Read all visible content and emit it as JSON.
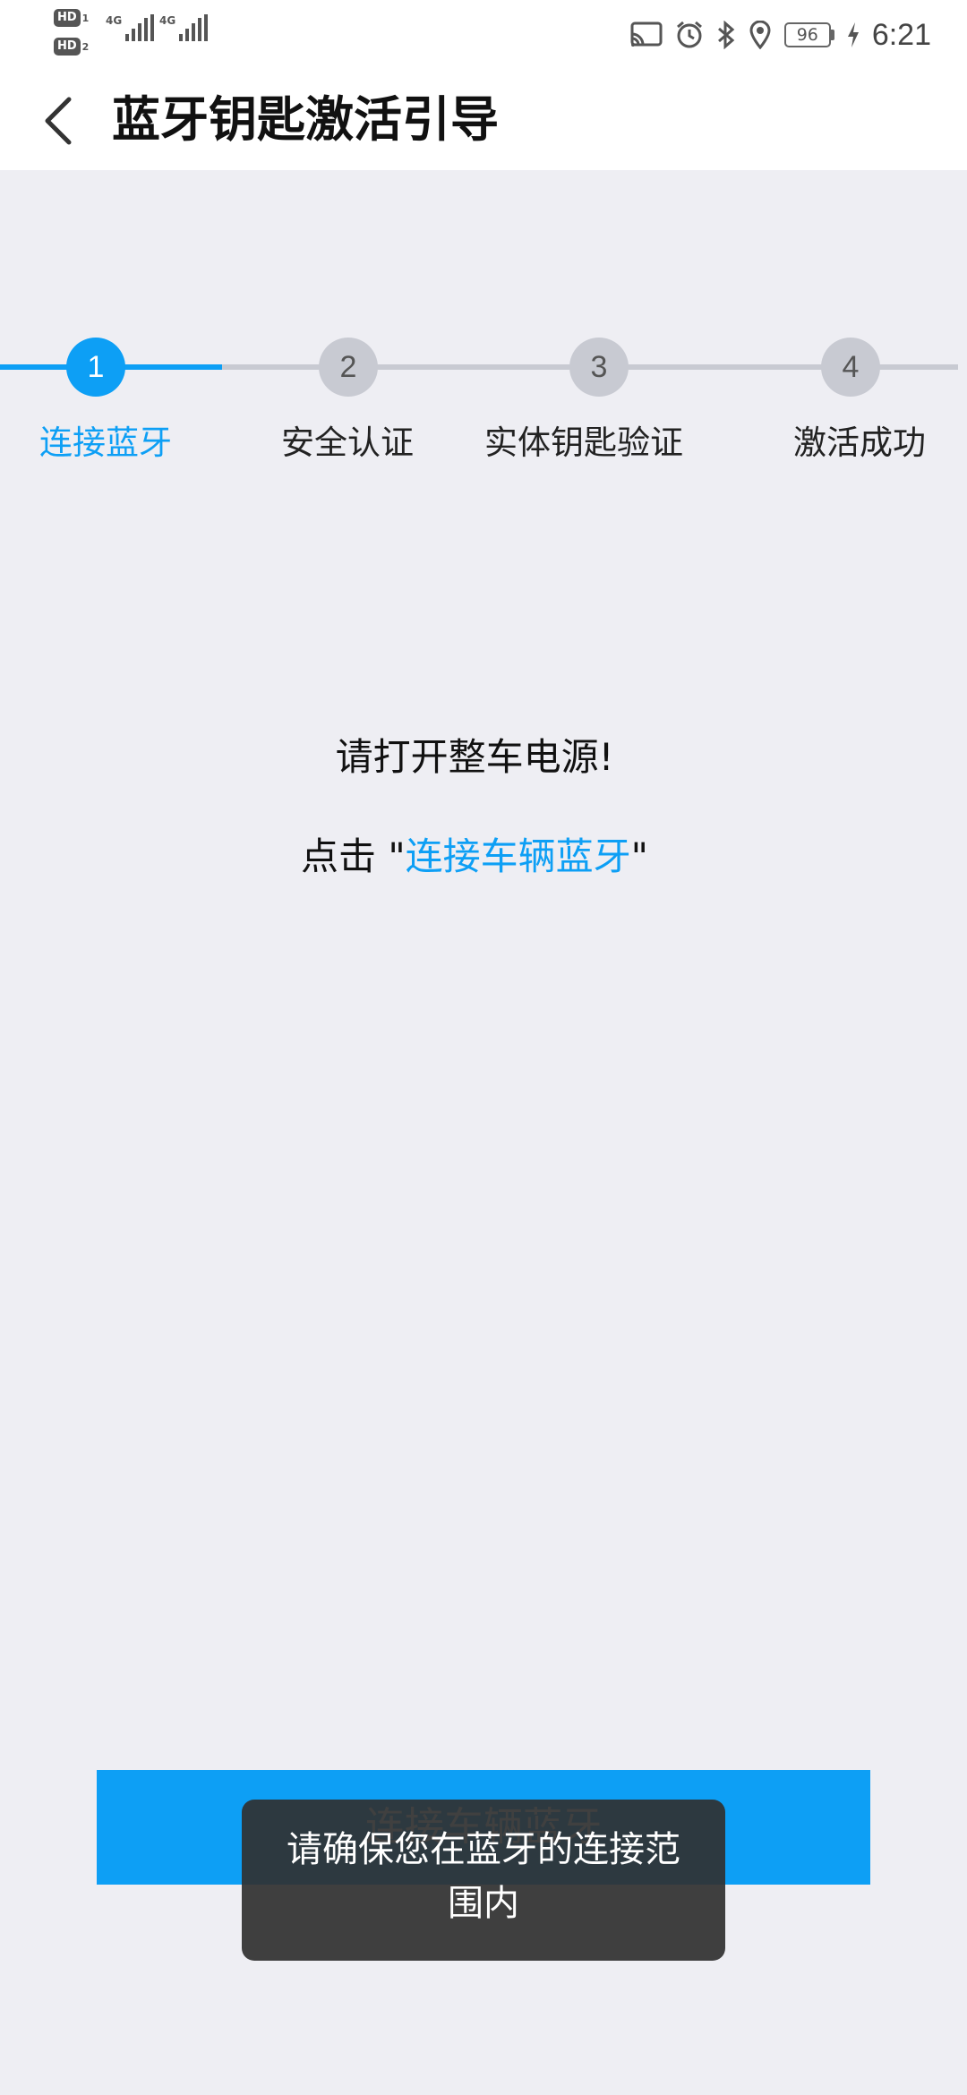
{
  "status_bar": {
    "sim1_badge": "HD",
    "sim1_num": "1",
    "sim2_badge": "HD",
    "sim2_num": "2",
    "network1": "4G",
    "network2": "4G",
    "battery": "96",
    "time": "6:21"
  },
  "header": {
    "title": "蓝牙钥匙激活引导",
    "back_icon": "chevron-left-icon"
  },
  "stepper": {
    "active_step": 1,
    "steps": [
      {
        "number": "1",
        "label": "连接蓝牙"
      },
      {
        "number": "2",
        "label": "安全认证"
      },
      {
        "number": "3",
        "label": "实体钥匙验证"
      },
      {
        "number": "4",
        "label": "激活成功"
      }
    ]
  },
  "instructions": {
    "line1": "请打开整车电源!",
    "line2_prefix": "点击 \"",
    "line2_link": "连接车辆蓝牙",
    "line2_suffix": "\""
  },
  "connect_button": {
    "label": "连接车辆蓝牙"
  },
  "toast": {
    "message": "请确保您在蓝牙的连接范围内"
  },
  "colors": {
    "accent": "#0d9ff5",
    "background": "#eeeef3",
    "inactive": "#c8cad2"
  }
}
